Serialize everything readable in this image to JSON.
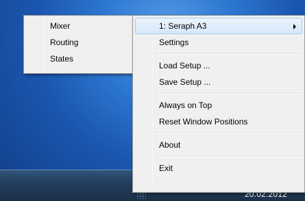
{
  "taskbar": {
    "date": "20.02.2012"
  },
  "submenu": {
    "items": [
      {
        "label": "Mixer"
      },
      {
        "label": "Routing"
      },
      {
        "label": "States"
      }
    ]
  },
  "mainmenu": {
    "device": {
      "label": "1: Seraph A3"
    },
    "settings": {
      "label": "Settings"
    },
    "load_setup": {
      "label": "Load Setup ..."
    },
    "save_setup": {
      "label": "Save Setup ..."
    },
    "always_on_top": {
      "label": "Always on Top"
    },
    "reset_window_positions": {
      "label": "Reset Window Positions"
    },
    "about": {
      "label": "About"
    },
    "exit": {
      "label": "Exit"
    }
  }
}
